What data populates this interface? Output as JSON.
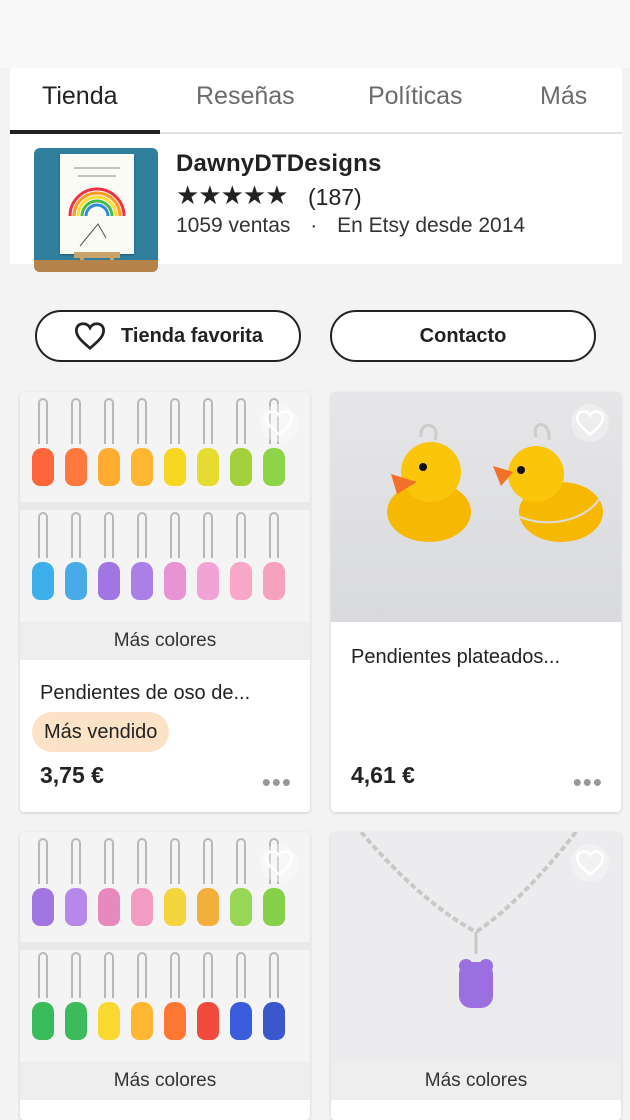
{
  "tabs": [
    "Tienda",
    "Reseñas",
    "Políticas",
    "Más"
  ],
  "shop": {
    "name": "DawnyDTDesigns",
    "rating_stars": "★★★★★",
    "review_count": "(187)",
    "sales": "1059 ventas",
    "separator": "·",
    "since": "En Etsy desde 2014"
  },
  "buttons": {
    "favorite": "Tienda favorita",
    "contact": "Contacto"
  },
  "products": [
    {
      "more_colors": "Más colores",
      "title": "Pendientes de oso de...",
      "badge": "Más vendido",
      "price": "3,75 €",
      "more": "•••"
    },
    {
      "title": "Pendientes plateados...",
      "price": "4,61 €",
      "more": "•••"
    },
    {
      "more_colors": "Más colores"
    },
    {
      "more_colors": "Más colores"
    }
  ],
  "colors": {
    "accent_badge": "#fce3c7",
    "text": "#222222"
  }
}
